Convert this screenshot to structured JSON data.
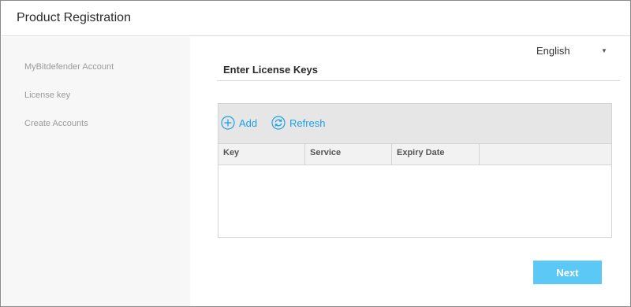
{
  "window": {
    "title": "Product Registration"
  },
  "sidebar": {
    "items": [
      {
        "label": "MyBitdefender Account"
      },
      {
        "label": "License key"
      },
      {
        "label": "Create Accounts"
      }
    ]
  },
  "language": {
    "selected": "English"
  },
  "main": {
    "section_title": "Enter License Keys",
    "toolbar": {
      "add_label": "Add",
      "refresh_label": "Refresh"
    },
    "table": {
      "columns": [
        "Key",
        "Service",
        "Expiry Date",
        ""
      ],
      "rows": []
    },
    "next_label": "Next"
  },
  "colors": {
    "accent": "#1ea1e6",
    "button": "#5bc8f5",
    "sidebar_bg": "#f7f7f7",
    "toolbar_bg": "#e6e6e6"
  },
  "icons": {
    "add": "plus-circle-icon",
    "refresh": "refresh-circle-icon",
    "dropdown": "caret-down-icon"
  }
}
